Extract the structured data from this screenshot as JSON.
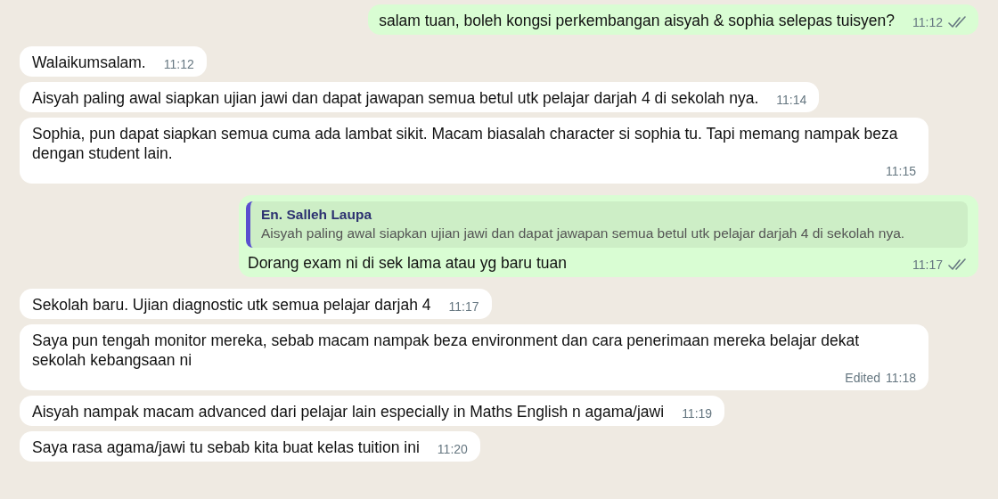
{
  "messages": [
    {
      "kind": "outgoing",
      "text": "salam tuan, boleh kongsi perkembangan aisyah & sophia selepas tuisyen?",
      "time": "11:12",
      "read": false
    },
    {
      "kind": "incoming",
      "text": "Walaikumsalam.",
      "time": "11:12"
    },
    {
      "kind": "incoming",
      "text": "Aisyah paling awal siapkan ujian jawi dan dapat jawapan semua betul utk pelajar darjah 4 di sekolah nya.",
      "time": "11:14"
    },
    {
      "kind": "incoming",
      "text": "Sophia, pun dapat siapkan semua cuma ada lambat sikit. Macam biasalah character si sophia tu. Tapi memang nampak beza dengan student lain.",
      "time": "11:15"
    },
    {
      "kind": "outgoing",
      "quote": {
        "author": "En. Salleh Laupa",
        "text": "Aisyah paling awal siapkan ujian jawi dan dapat jawapan semua betul utk pelajar darjah 4 di sekolah nya."
      },
      "text": "Dorang exam ni di sek lama atau yg baru tuan",
      "time": "11:17",
      "read": false
    },
    {
      "kind": "incoming",
      "text": "Sekolah baru. Ujian diagnostic utk semua pelajar darjah 4",
      "time": "11:17"
    },
    {
      "kind": "incoming",
      "text": "Saya pun tengah monitor mereka, sebab macam nampak beza environment dan cara penerimaan mereka belajar dekat sekolah kebangsaan ni",
      "edited": "Edited",
      "time": "11:18"
    },
    {
      "kind": "incoming",
      "text": "Aisyah nampak macam advanced dari pelajar lain especially in Maths English n agama/jawi",
      "time": "11:19"
    },
    {
      "kind": "incoming",
      "text": "Saya rasa agama/jawi tu sebab kita buat kelas tuition ini",
      "time": "11:20"
    }
  ]
}
